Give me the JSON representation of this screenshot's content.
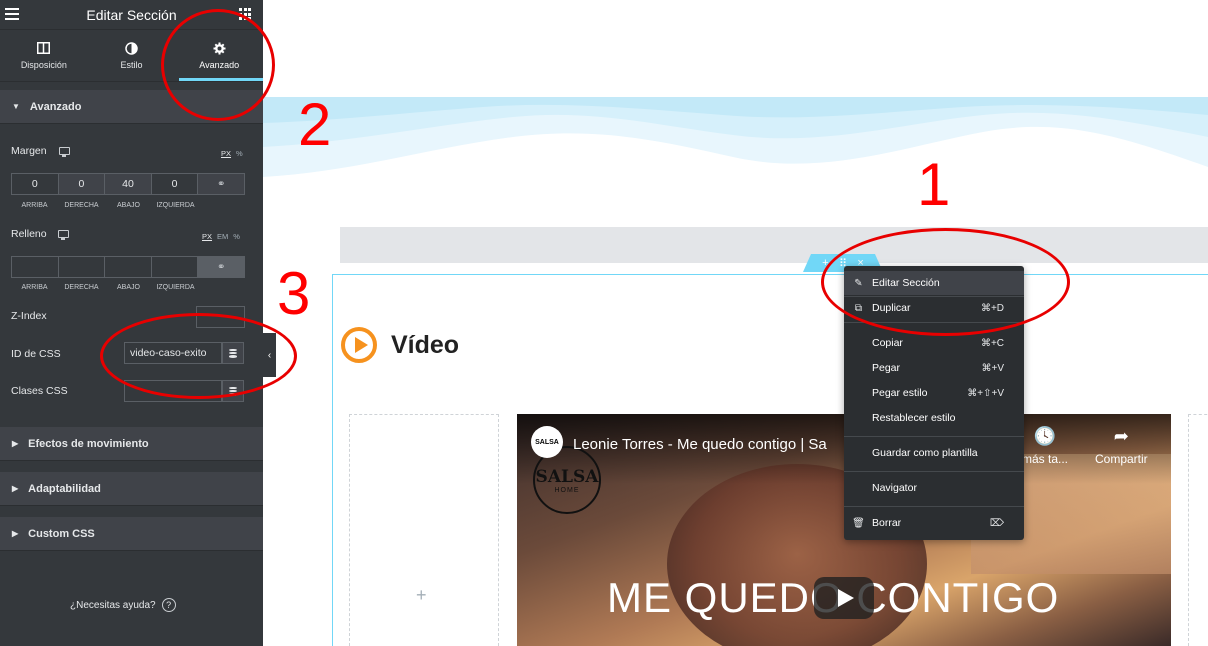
{
  "panel": {
    "title": "Editar Sección",
    "tabs": [
      {
        "label": "Disposición",
        "icon": "layout-icon"
      },
      {
        "label": "Estilo",
        "icon": "contrast-icon"
      },
      {
        "label": "Avanzado",
        "icon": "gear-icon",
        "active": true
      }
    ],
    "sections": {
      "advanced": "Avanzado",
      "motion": "Efectos de movimiento",
      "responsive": "Adaptabilidad",
      "custom_css": "Custom CSS"
    },
    "margin": {
      "label": "Margen",
      "units": [
        "PX",
        "%"
      ],
      "active_unit": "PX",
      "values": [
        "0",
        "0",
        "40",
        "0"
      ],
      "sides": [
        "ARRIBA",
        "DERECHA",
        "ABAJO",
        "IZQUIERDA"
      ]
    },
    "padding": {
      "label": "Relleno",
      "units": [
        "PX",
        "EM",
        "%"
      ],
      "active_unit": "PX",
      "values": [
        "",
        "",
        "",
        ""
      ],
      "sides": [
        "ARRIBA",
        "DERECHA",
        "ABAJO",
        "IZQUIERDA"
      ]
    },
    "zindex": {
      "label": "Z-Index",
      "value": ""
    },
    "css_id": {
      "label": "ID de CSS",
      "value": "video-caso-exito"
    },
    "css_classes": {
      "label": "Clases CSS",
      "value": ""
    },
    "help": "¿Necesitas ayuda?"
  },
  "canvas": {
    "heading": "Vídeo",
    "video": {
      "title": "Leonie Torres - Me quedo contigo | Sa",
      "channel_logo_small": "SALSA",
      "channel_logo_big": "SALSA",
      "channel_logo_sub": "HOME",
      "watch_later": "más ta...",
      "share": "Compartir",
      "overlay_text": "ME QUEDO CONTIGO"
    },
    "handle_icons": [
      "+",
      "⠿",
      "×"
    ]
  },
  "context_menu": {
    "items": [
      {
        "label": "Editar Sección",
        "icon": "pencil-icon",
        "shortcut": ""
      },
      {
        "label": "Duplicar",
        "icon": "copy-icon",
        "shortcut": "⌘+D"
      },
      {
        "label": "Copiar",
        "icon": "",
        "shortcut": "⌘+C"
      },
      {
        "label": "Pegar",
        "icon": "",
        "shortcut": "⌘+V"
      },
      {
        "label": "Pegar estilo",
        "icon": "",
        "shortcut": "⌘+⇧+V"
      },
      {
        "label": "Restablecer estilo",
        "icon": "",
        "shortcut": ""
      },
      {
        "label": "Guardar como plantilla",
        "icon": "",
        "shortcut": ""
      },
      {
        "label": "Navigator",
        "icon": "",
        "shortcut": ""
      },
      {
        "label": "Borrar",
        "icon": "trash-icon",
        "shortcut": "⌦"
      }
    ]
  },
  "annotations": {
    "n1": "1",
    "n2": "2",
    "n3": "3",
    "color": "#e80000"
  },
  "colors": {
    "panel_bg": "#34383c",
    "accent": "#71d7f7",
    "play_icon": "#f6921e"
  }
}
